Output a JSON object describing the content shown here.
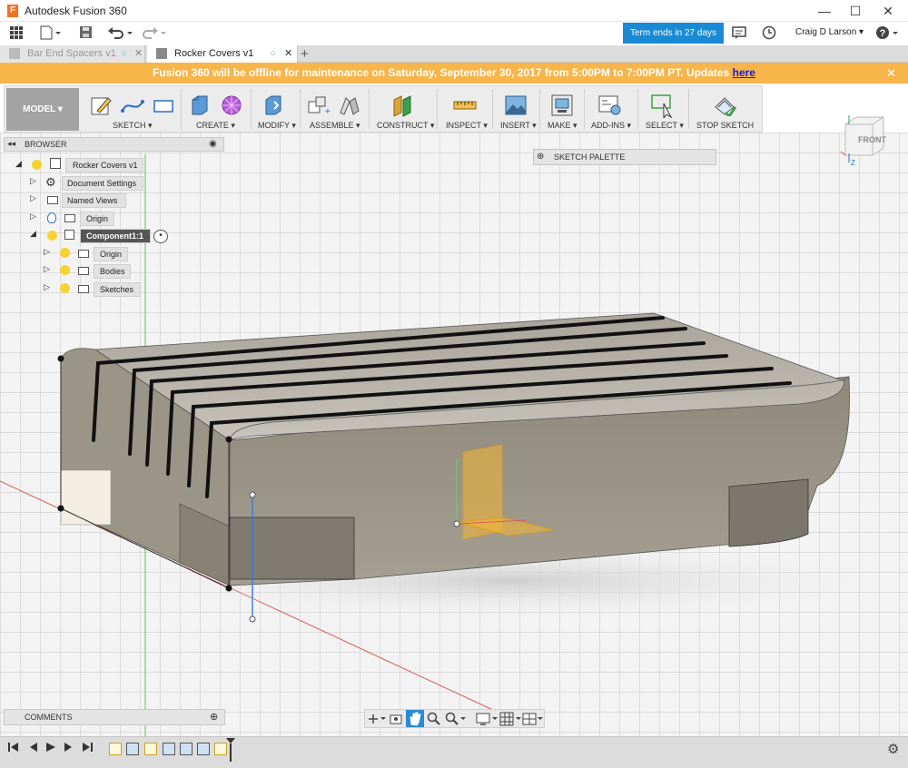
{
  "window": {
    "app_title": "Autodesk Fusion 360",
    "minimize": "—",
    "maximize": "☐",
    "close": "✕"
  },
  "topbar": {
    "term_label": "Term ends in 27 days",
    "user": "Craig D Larson ▾",
    "help": "?"
  },
  "tabs": [
    {
      "label": "Bar End Spacers v1",
      "active": false
    },
    {
      "label": "Rocker Covers v1",
      "active": true
    }
  ],
  "banner": {
    "text": "Fusion 360 will be offline for maintenance on Saturday, September 30, 2017 from 5:00PM to 7:00PM PT. Updates ",
    "link": "here",
    "color": "#f7b54a"
  },
  "toolbar": {
    "workspace": "MODEL ▾",
    "groups": [
      "SKETCH ▾",
      "CREATE ▾",
      "MODIFY ▾",
      "ASSEMBLE ▾",
      "CONSTRUCT ▾",
      "INSPECT ▾",
      "INSERT ▾",
      "MAKE ▾",
      "ADD-INS ▾",
      "SELECT ▾",
      "STOP SKETCH"
    ]
  },
  "browser": {
    "title": "BROWSER",
    "root": "Rocker Covers v1",
    "items": [
      {
        "label": "Document Settings",
        "icon": "gear-icon"
      },
      {
        "label": "Named Views",
        "icon": "folder-icon"
      },
      {
        "label": "Origin",
        "icon": "folder-icon"
      },
      {
        "label": "Component1:1",
        "icon": "component-icon"
      },
      {
        "label": "Origin",
        "icon": "folder-icon"
      },
      {
        "label": "Bodies",
        "icon": "folder-icon"
      },
      {
        "label": "Sketches",
        "icon": "folder-icon"
      }
    ]
  },
  "sketch_palette": {
    "label": "SKETCH PALETTE"
  },
  "viewcube": {
    "face": "FRONT",
    "axis_z": "Z",
    "axis_x": "X"
  },
  "comments": {
    "label": "COMMENTS"
  },
  "colors": {
    "accent": "#1a8ad4",
    "body": "#9a9384",
    "sketch_line": "#111111",
    "origin_y": "#3a7bd5"
  }
}
